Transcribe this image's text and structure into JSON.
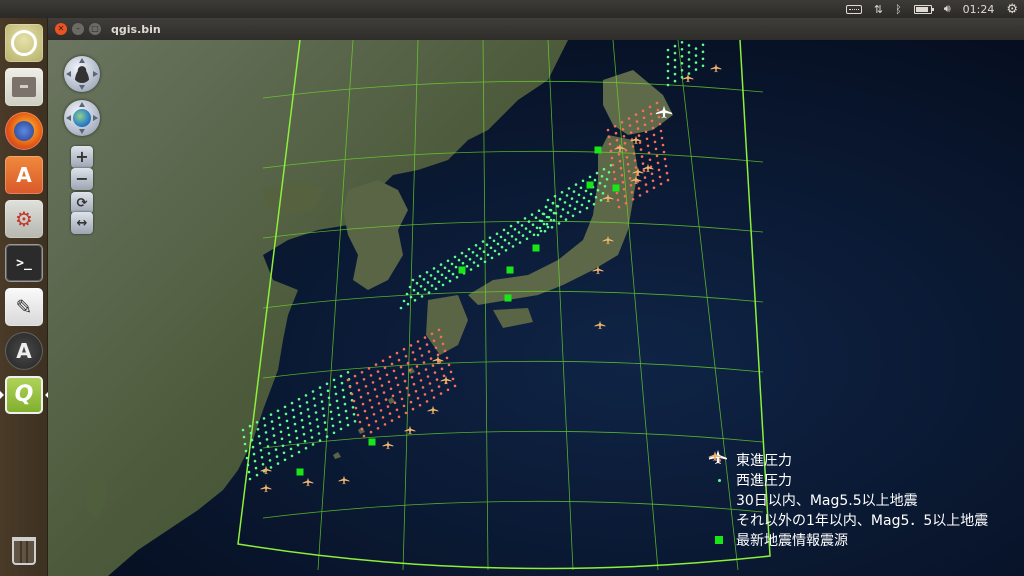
{
  "top_panel": {
    "clock": "01:24"
  },
  "window": {
    "title": "qgis.bin"
  },
  "nav_controls": {
    "zoom_in": "+",
    "zoom_out": "−"
  },
  "legend": {
    "items": [
      {
        "label": "東進圧力",
        "symbol": "red-dot",
        "color": "#ff6b5a"
      },
      {
        "label": "西進圧力",
        "symbol": "green-dot",
        "color": "#5cff8c"
      },
      {
        "label": "30日以内、Mag5.5以上地震",
        "symbol": "white-plane-icon",
        "color": "#ffffff"
      },
      {
        "label": "それ以外の1年以内、Mag5．5以上地震",
        "symbol": "orange-plane-icon",
        "color": "#f0b46e"
      },
      {
        "label": "最新地震情報震源",
        "symbol": "green-square",
        "color": "#19e619"
      }
    ]
  },
  "colors": {
    "graticule": "#6fe02a",
    "ocean": "#0b1a33",
    "land": "#4a5a3a"
  }
}
